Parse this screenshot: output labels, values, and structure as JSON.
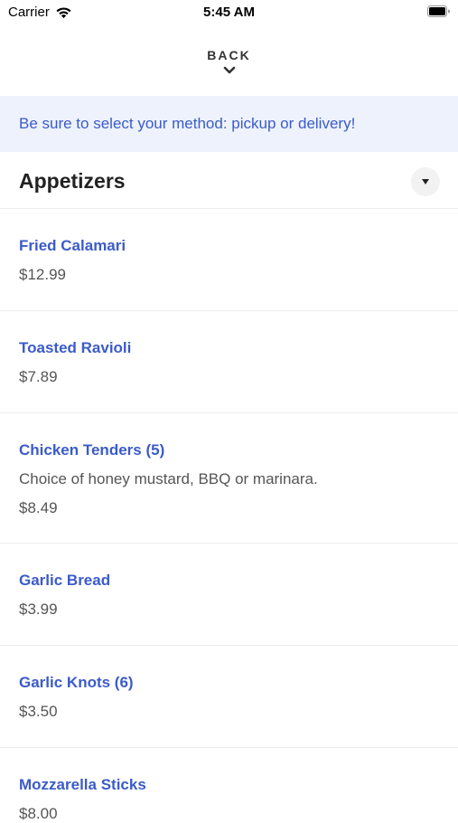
{
  "status_bar": {
    "carrier": "Carrier",
    "time": "5:45 AM"
  },
  "nav": {
    "back_label": "BACK"
  },
  "banner": {
    "text": "Be sure to select your method: pickup or delivery!"
  },
  "section": {
    "title": "Appetizers"
  },
  "items": [
    {
      "name": "Fried Calamari",
      "description": "",
      "price": "$12.99"
    },
    {
      "name": "Toasted Ravioli",
      "description": "",
      "price": "$7.89"
    },
    {
      "name": "Chicken Tenders (5)",
      "description": "Choice of honey mustard, BBQ or marinara.",
      "price": "$8.49"
    },
    {
      "name": "Garlic Bread",
      "description": "",
      "price": "$3.99"
    },
    {
      "name": "Garlic Knots (6)",
      "description": "",
      "price": "$3.50"
    },
    {
      "name": "Mozzarella Sticks",
      "description": "",
      "price": "$8.00"
    }
  ],
  "colors": {
    "accent": "#3b5bc9",
    "banner_bg": "#eef2fc",
    "divider": "#ededed"
  },
  "icons": {
    "wifi": "wifi-icon",
    "battery": "battery-icon",
    "back": "chevron-down-icon",
    "collapse": "triangle-down-icon"
  }
}
